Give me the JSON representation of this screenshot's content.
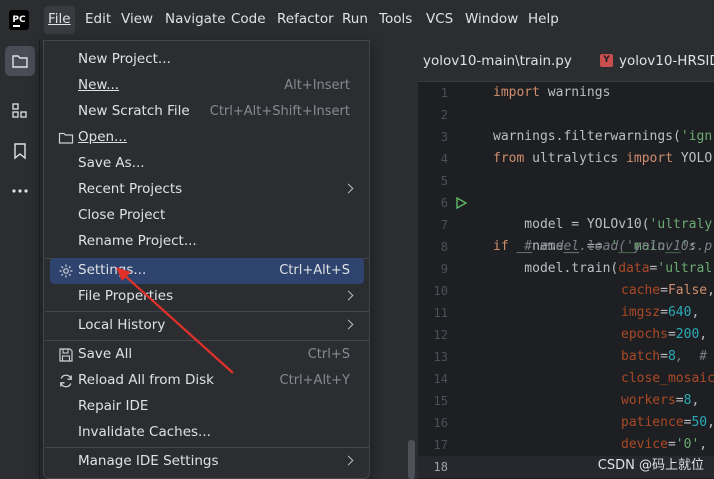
{
  "menubar": {
    "items": [
      "File",
      "Edit",
      "View",
      "Navigate",
      "Code",
      "Refactor",
      "Run",
      "Tools",
      "VCS",
      "Window",
      "Help"
    ],
    "logo_text": "PC"
  },
  "tabs": [
    "yolov10-main\\train.py",
    "yolov10-HRSID\\"
  ],
  "file_menu": [
    {
      "label": "New Project...",
      "shortcut": ""
    },
    {
      "label": "New...",
      "shortcut": "Alt+Insert"
    },
    {
      "label": "New Scratch File",
      "shortcut": "Ctrl+Alt+Shift+Insert"
    },
    {
      "label": "Open...",
      "shortcut": ""
    },
    {
      "label": "Save As...",
      "shortcut": ""
    },
    {
      "label": "Recent Projects",
      "shortcut": ""
    },
    {
      "label": "Close Project",
      "shortcut": ""
    },
    {
      "label": "Rename Project...",
      "shortcut": ""
    },
    {
      "label": "Settings...",
      "shortcut": "Ctrl+Alt+S"
    },
    {
      "label": "File Properties",
      "shortcut": ""
    },
    {
      "label": "Local History",
      "shortcut": ""
    },
    {
      "label": "Save All",
      "shortcut": "Ctrl+S"
    },
    {
      "label": "Reload All from Disk",
      "shortcut": "Ctrl+Alt+Y"
    },
    {
      "label": "Repair IDE",
      "shortcut": ""
    },
    {
      "label": "Invalidate Caches...",
      "shortcut": ""
    },
    {
      "label": "Manage IDE Settings",
      "shortcut": ""
    }
  ],
  "editor": {
    "line_numbers": [
      "1",
      "2",
      "3",
      "4",
      "5",
      "6",
      "7",
      "8",
      "9",
      "10",
      "11",
      "12",
      "13",
      "14",
      "15",
      "16",
      "17",
      "18"
    ],
    "current_line": "18",
    "code": {
      "l1_kw": "import",
      "l1_rest": " warnings",
      "l3_a": "warnings.filterwarnings(",
      "l3_str": "'ign",
      "l4_kw1": "from",
      "l4_mid": " ultralytics ",
      "l4_kw2": "import",
      "l4_rest": " YOLO",
      "l6_kw": "if",
      "l6_mid": " __name__ == ",
      "l6_str": "'__main__'",
      "l6_end": ":",
      "l7_a": "    model = YOLOv10(",
      "l7_str": "'ultraly",
      "l8_cmt": "    # model.load('yolov10s.p",
      "l9_a": "    model.train(",
      "l9_param": "data",
      "l9_eq": "=",
      "l9_str": "'ultral",
      "l10_param": "cache",
      "l10_eq": "=",
      "l10_kw": "False",
      "l10_end": ",",
      "l11_param": "imgsz",
      "l11_eq": "=",
      "l11_num": "640",
      "l11_end": ",",
      "l12_param": "epochs",
      "l12_eq": "=",
      "l12_num": "200",
      "l12_end": ",",
      "l13_param": "batch",
      "l13_eq": "=",
      "l13_num": "8",
      "l13_end": ",  #",
      "l14_param": "close_mosaic",
      "l15_param": "workers",
      "l15_eq": "=",
      "l15_num": "8",
      "l15_end": ",",
      "l16_param": "patience",
      "l16_eq": "=",
      "l16_num": "50",
      "l16_end": ",",
      "l17_param": "device",
      "l17_eq": "=",
      "l17_str": "'0'",
      "l17_end": ","
    }
  },
  "watermark": "CSDN @码上就位",
  "colors": {
    "accent": "#2e436e",
    "annotation": "#e0302a"
  }
}
